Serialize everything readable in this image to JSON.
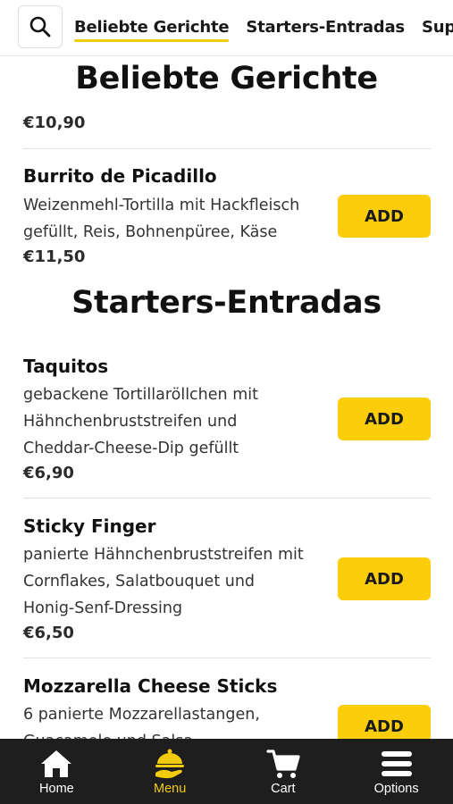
{
  "nav_tabs": [
    {
      "label": "Beliebte Gerichte",
      "active": true
    },
    {
      "label": "Starters-Entradas",
      "active": false
    },
    {
      "label": "Sup",
      "active": false
    }
  ],
  "sections": [
    {
      "title": "Beliebte Gerichte"
    },
    {
      "title": "Starters-Entradas"
    }
  ],
  "partial_item": {
    "price": "€10,90"
  },
  "items": [
    {
      "name": "Burrito de Picadillo",
      "desc_lines": [
        "Weizenmehl-Tortilla mit Hackfleisch",
        "gefüllt, Reis, Bohnenpüree, Käse"
      ],
      "price": "€11,50"
    },
    {
      "name": "Taquitos",
      "desc_lines": [
        "gebackene Tortillaröllchen mit",
        "Hähnchenbruststreifen und",
        "Cheddar-Cheese-Dip gefüllt"
      ],
      "price": "€6,90"
    },
    {
      "name": "Sticky Finger",
      "desc_lines": [
        "panierte Hähnchenbruststreifen mit",
        "Cornflakes, Salatbouquet und",
        "Honig-Senf-Dressing"
      ],
      "price": "€6,50"
    },
    {
      "name": "Mozzarella Cheese Sticks",
      "desc_lines": [
        "6 panierte Mozzarellastangen,",
        "Guacamole und Salsa"
      ],
      "price": ""
    }
  ],
  "add_label": "ADD",
  "bottom_nav": [
    {
      "label": "Home",
      "icon": "home-icon",
      "active": false
    },
    {
      "label": "Menu",
      "icon": "menu-cloche-icon",
      "active": true
    },
    {
      "label": "Cart",
      "icon": "cart-icon",
      "active": false
    },
    {
      "label": "Options",
      "icon": "hamburger-icon",
      "active": false
    }
  ],
  "colors": {
    "accent": "#fccd0a",
    "nav_bg": "#1e1e1e",
    "active_nav": "#f2cc0c"
  }
}
